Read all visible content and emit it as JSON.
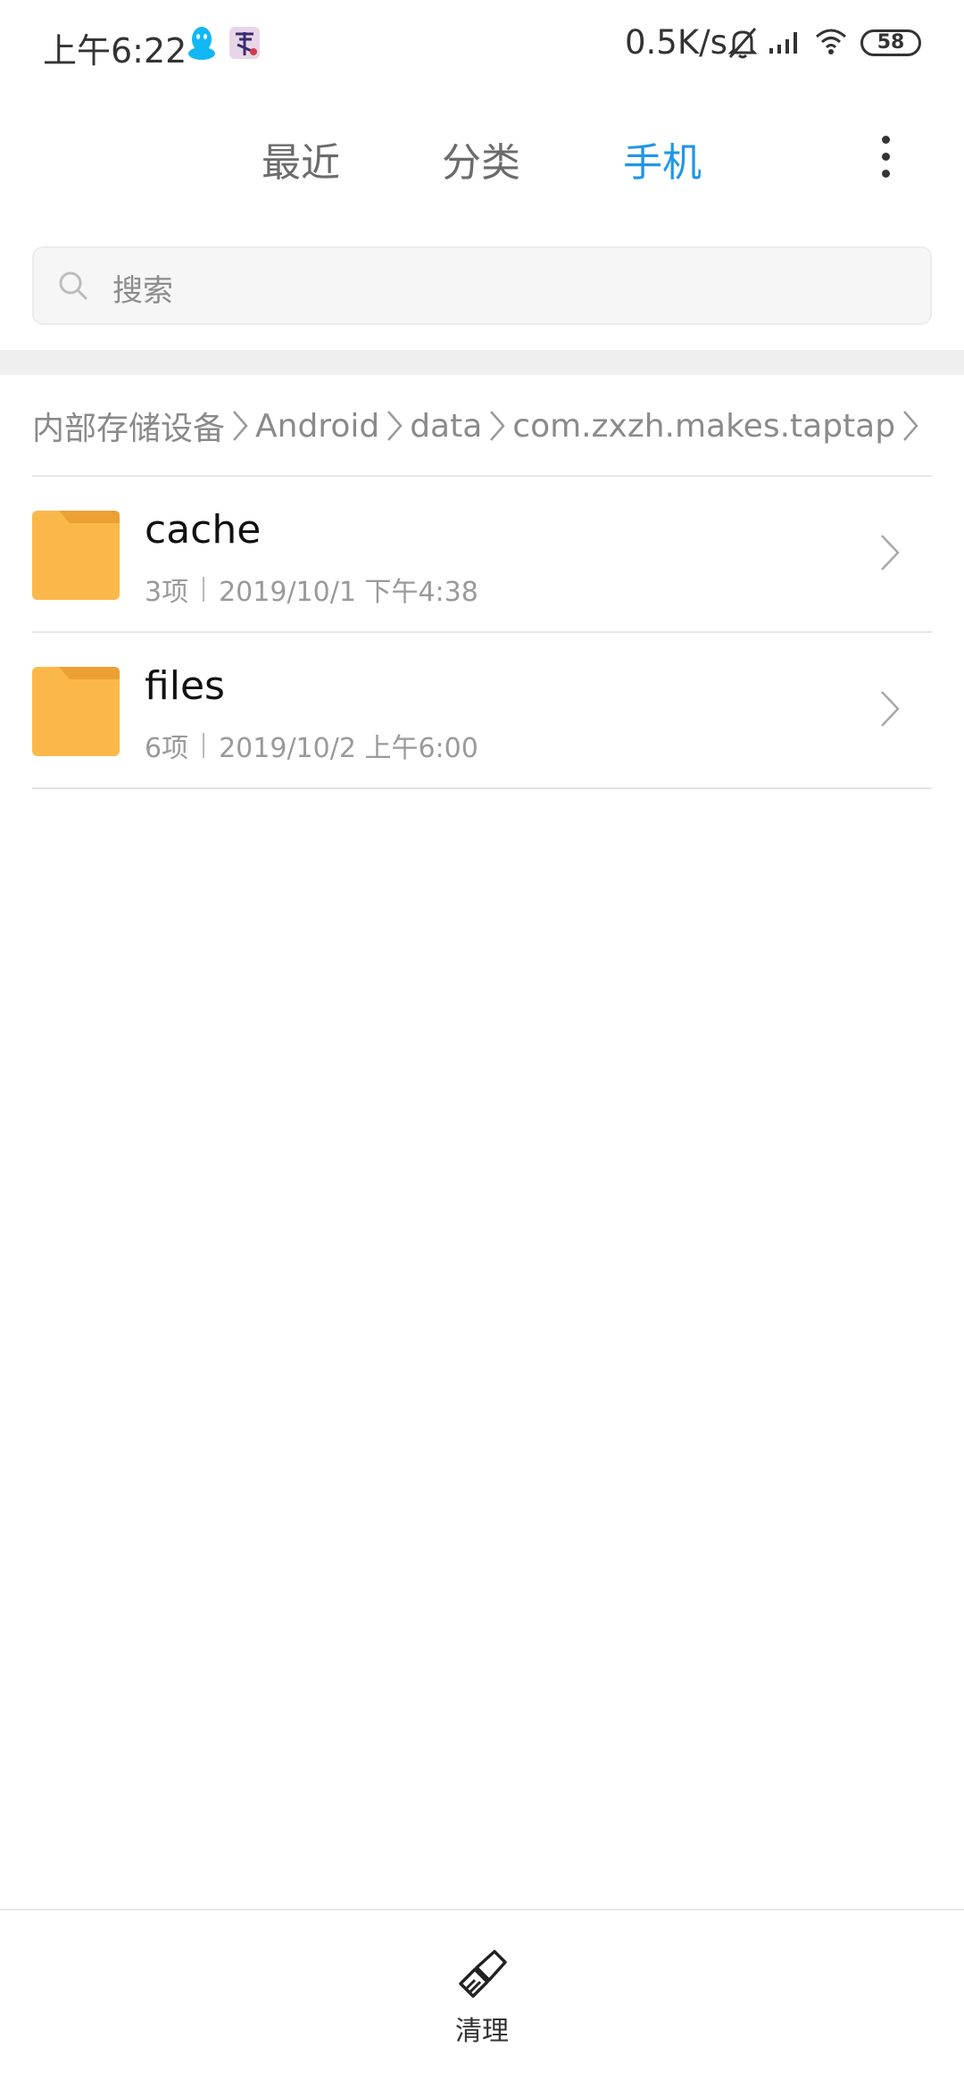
{
  "status_bar": {
    "time": "上午6:22",
    "net_speed": "0.5K/s",
    "battery": "58",
    "icons": [
      "qq-icon",
      "app-icon",
      "mute-icon",
      "signal-icon",
      "wifi-icon",
      "battery-icon"
    ]
  },
  "tabs": [
    {
      "label": "最近",
      "active": false
    },
    {
      "label": "分类",
      "active": false
    },
    {
      "label": "手机",
      "active": true
    }
  ],
  "search": {
    "placeholder": "搜索"
  },
  "breadcrumb": [
    "内部存储设备",
    "Android",
    "data",
    "com.zxzh.makes.taptap"
  ],
  "items": [
    {
      "name": "cache",
      "count": "3项",
      "date": "2019/10/1 下午4:38"
    },
    {
      "name": "files",
      "count": "6项",
      "date": "2019/10/2 上午6:00"
    }
  ],
  "bottom_bar": {
    "clean_label": "清理"
  },
  "colors": {
    "accent": "#2196e8",
    "folder": "#fbb84a",
    "folder_tab": "#eda034"
  }
}
